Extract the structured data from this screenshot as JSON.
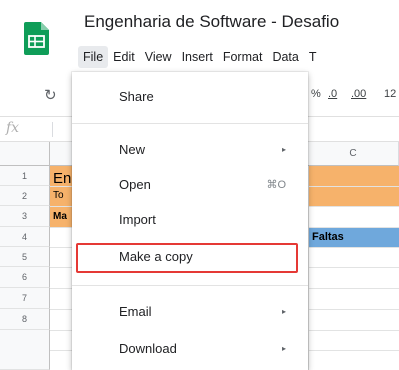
{
  "app": {
    "title": "Engenharia de Software - Desafio",
    "icon": "google-sheets-icon"
  },
  "menubar": {
    "items": [
      {
        "label": "File"
      },
      {
        "label": "Edit"
      },
      {
        "label": "View"
      },
      {
        "label": "Insert"
      },
      {
        "label": "Format"
      },
      {
        "label": "Data"
      },
      {
        "label": "T"
      }
    ]
  },
  "toolbar": {
    "undo_icon": "undo-icon",
    "percent": "%",
    "decrease_decimal": ".0",
    "increase_decimal": ".00",
    "more_formats": "12"
  },
  "formula_bar": {
    "fx_label": "fx"
  },
  "grid": {
    "columns": [
      "C"
    ],
    "rows": [
      "1",
      "2",
      "3",
      "4",
      "5",
      "6",
      "7",
      "8"
    ],
    "cells": {
      "a1": "En",
      "a2": "To",
      "a3": "Ma",
      "c3": "Faltas"
    },
    "colors": {
      "orange": "#f6b26b",
      "blue": "#6fa8dc"
    }
  },
  "file_menu": {
    "items": [
      {
        "label": "Share"
      },
      {
        "label": "New",
        "submenu": "▸"
      },
      {
        "label": "Open",
        "shortcut": "⌘O"
      },
      {
        "label": "Import"
      },
      {
        "label": "Make a copy",
        "highlighted": true
      },
      {
        "label": "Email",
        "submenu": "▸"
      },
      {
        "label": "Download",
        "submenu": "▸"
      }
    ],
    "highlight_color": "#e53935"
  }
}
